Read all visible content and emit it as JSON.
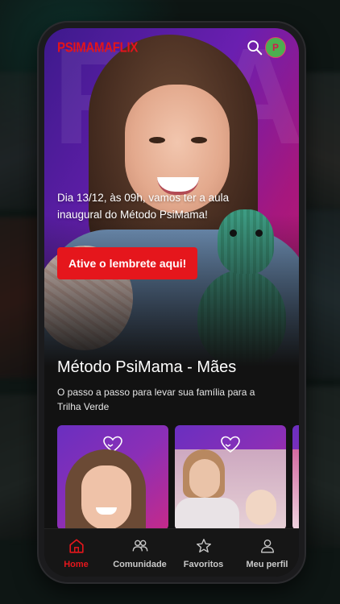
{
  "app": {
    "logo": "PSIMAMAFLIX",
    "avatar_initial": "P"
  },
  "hero": {
    "announcement": "Dia 13/12, às 09h, vamos ter a aula inaugural do Método PsiMama!",
    "cta_label": "Ative o lembrete aqui!"
  },
  "section": {
    "title": "Método PsiMama - Mães",
    "description": "O passo a passo para levar sua família para a Trilha Verde"
  },
  "nav": {
    "items": [
      {
        "label": "Home",
        "icon": "home-icon",
        "active": true
      },
      {
        "label": "Comunidade",
        "icon": "community-icon",
        "active": false
      },
      {
        "label": "Favoritos",
        "icon": "star-icon",
        "active": false
      },
      {
        "label": "Meu perfil",
        "icon": "profile-icon",
        "active": false
      }
    ]
  },
  "colors": {
    "brand_red": "#e5161c",
    "hero_purple": "#6a1fb0",
    "hero_pink": "#c21a6d",
    "nav_bg": "#161616"
  }
}
